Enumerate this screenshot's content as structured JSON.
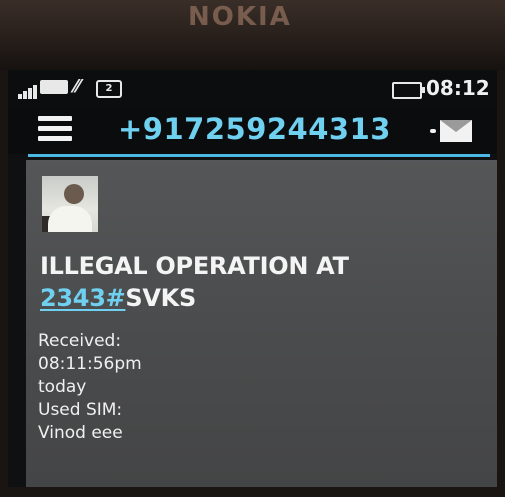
{
  "device": {
    "brand": "NOKIA"
  },
  "status_bar": {
    "time": "08:12",
    "sim_indicator": "2",
    "icons": [
      "signal-icon",
      "network-icon",
      "sim-icon",
      "battery-icon"
    ]
  },
  "header": {
    "sender": "+917259244313",
    "icons": [
      "menu-icon",
      "envelope-icon"
    ]
  },
  "message": {
    "line1": "ILLEGAL OPERATION AT",
    "link_text": "2343#",
    "line2_rest": "SVKS"
  },
  "details": {
    "received_label": "Received:",
    "received_time": "08:11:56pm",
    "received_day": "today",
    "used_sim_label": "Used SIM:",
    "used_sim_value": "Vinod eee"
  },
  "colors": {
    "accent": "#4cb8e6",
    "sender": "#6fd0f0",
    "panel": "#4b4c4d"
  }
}
